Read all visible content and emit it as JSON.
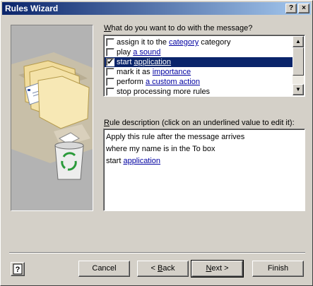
{
  "window": {
    "title": "Rules Wizard",
    "help_glyph": "?",
    "close_glyph": "×"
  },
  "colors": {
    "titlebar_start": "#0a246a",
    "titlebar_end": "#a6caf0",
    "selection": "#0a246a",
    "link": "#0000a0",
    "face": "#d4d0c8"
  },
  "actions": {
    "prompt_prefix": "W",
    "prompt_rest": "hat do you want to do with the message?",
    "items": [
      {
        "checked": false,
        "pre": "assign it to the ",
        "link": "category",
        "post": " category"
      },
      {
        "checked": false,
        "pre": "play ",
        "link": "a sound",
        "post": ""
      },
      {
        "checked": true,
        "pre": "start ",
        "link": "application",
        "post": ""
      },
      {
        "checked": false,
        "pre": "mark it as ",
        "link": "importance",
        "post": ""
      },
      {
        "checked": false,
        "pre": "perform ",
        "link": "a custom action",
        "post": ""
      },
      {
        "checked": false,
        "pre": "stop processing more rules",
        "link": "",
        "post": ""
      }
    ],
    "selected_index": 2
  },
  "description": {
    "label_prefix": "R",
    "label_rest": "ule description (click on an underlined value to edit it):",
    "line1": "Apply this rule after the message arrives",
    "line2": "where my name is in the To box",
    "line3_pre": "start ",
    "line3_link": "application"
  },
  "buttons": {
    "help_icon": "help-icon",
    "cancel": "Cancel",
    "back_pre": "< ",
    "back_accel": "B",
    "back_post": "ack",
    "next_accel": "N",
    "next_post": "ext >",
    "finish": "Finish"
  }
}
